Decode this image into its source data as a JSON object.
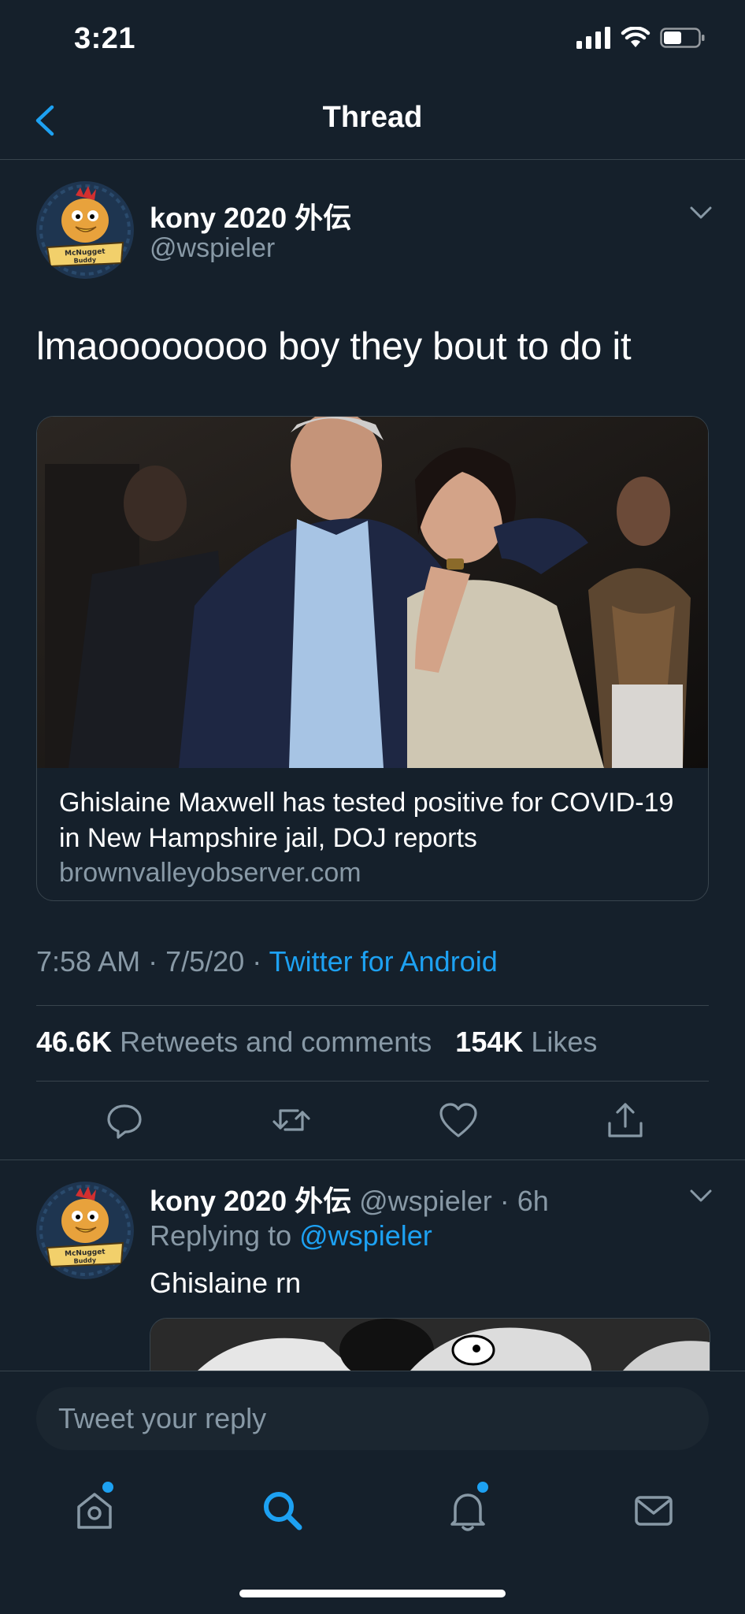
{
  "status_bar": {
    "time": "3:21"
  },
  "header": {
    "title": "Thread"
  },
  "tweet": {
    "author_name": "kony 2020 外伝",
    "author_handle": "@wspieler",
    "avatar_caption": "McNugget Buddy",
    "text": "lmaoooooooo boy they bout to do it",
    "card": {
      "title": "Ghislaine Maxwell has tested positive for COVID-19 in New Hampshire jail, DOJ reports",
      "domain": "brownvalleyobserver.com"
    },
    "time": "7:58 AM",
    "date": "7/5/20",
    "separator": "·",
    "source": "Twitter for Android",
    "retweets_count": "46.6K",
    "retweets_label": "Retweets and comments",
    "likes_count": "154K",
    "likes_label": "Likes"
  },
  "reply": {
    "author_name": "kony 2020 外伝",
    "author_handle": "@wspieler",
    "age": "6h",
    "replying_label": "Replying to",
    "replying_handle": "@wspieler",
    "text": "Ghislaine rn"
  },
  "composer": {
    "placeholder": "Tweet your reply"
  },
  "colors": {
    "background": "#15202b",
    "accent": "#1da1f2",
    "secondary_text": "#8899a6",
    "divider": "#38444d"
  },
  "icons": [
    "signal-icon",
    "wifi-icon",
    "battery-icon",
    "back-chevron-icon",
    "chevron-down-icon",
    "reply-icon",
    "retweet-icon",
    "like-icon",
    "share-icon",
    "home-icon",
    "search-icon",
    "notifications-icon",
    "messages-icon"
  ]
}
